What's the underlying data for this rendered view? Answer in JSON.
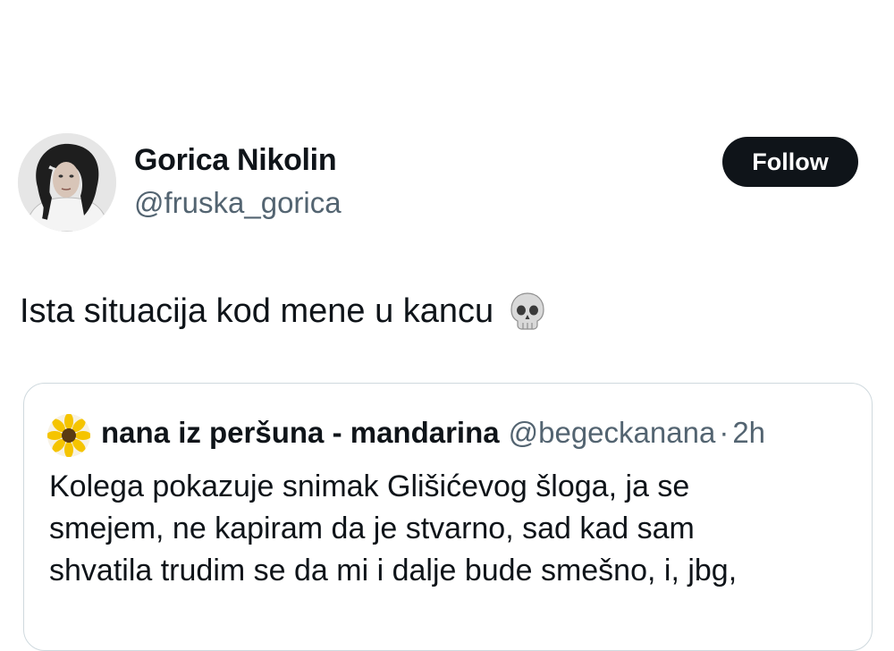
{
  "author": {
    "name": "Gorica Nikolin",
    "handle": "@fruska_gorica",
    "avatar_icon": "person-portrait-icon"
  },
  "follow_label": "Follow",
  "tweet": {
    "text": "Ista situacija kod mene u kancu",
    "emoji_icon": "skull-icon"
  },
  "quoted": {
    "name": "nana iz peršuna - mandarina",
    "handle": "@begeckanana",
    "separator": "·",
    "time": "2h",
    "avatar_icon": "sunflower-icon",
    "lines": [
      "Kolega pokazuje snimak Glišićevog šloga, ja se",
      "smejem, ne kapiram da je stvarno, sad kad sam",
      "shvatila trudim se da mi i dalje bude smešno, i, jbg,"
    ]
  },
  "colors": {
    "text": "#0f1419",
    "secondary": "#536471",
    "button_bg": "#0f1419",
    "border": "#cfd9de"
  }
}
